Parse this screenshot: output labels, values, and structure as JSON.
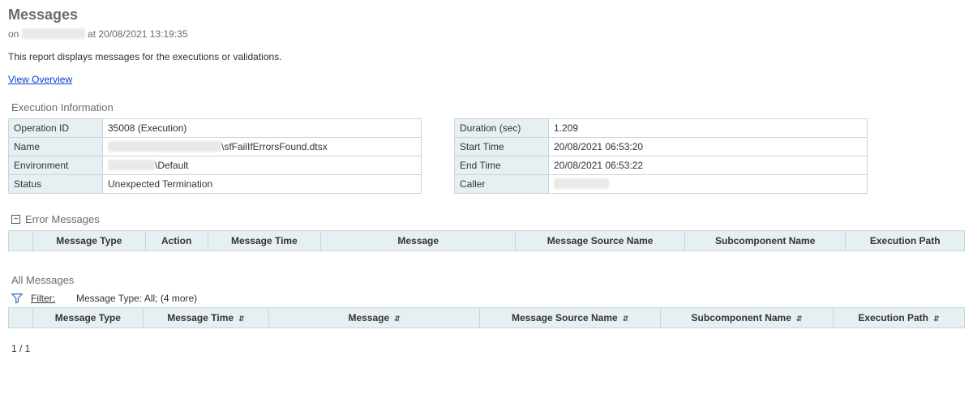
{
  "page": {
    "title": "Messages",
    "meta_prefix": "on",
    "meta_at": "at",
    "meta_datetime": "20/08/2021 13:19:35",
    "description": "This report displays messages for the executions or validations.",
    "overview_link": "View Overview"
  },
  "exec_info": {
    "heading": "Execution Information",
    "left": [
      {
        "label": "Operation ID",
        "value": "35008 (Execution)"
      },
      {
        "label": "Name",
        "value": "\\sfFailIfErrorsFound.dtsx",
        "redacted_prefix": true
      },
      {
        "label": "Environment",
        "value": "\\Default",
        "redacted_prefix": true
      },
      {
        "label": "Status",
        "value": "Unexpected Termination"
      }
    ],
    "right": [
      {
        "label": "Duration (sec)",
        "value": "1.209"
      },
      {
        "label": "Start Time",
        "value": "20/08/2021 06:53:20"
      },
      {
        "label": "End Time",
        "value": "20/08/2021 06:53:22"
      },
      {
        "label": "Caller",
        "value": "",
        "redacted_value": true
      }
    ]
  },
  "error_section": {
    "heading": "Error Messages",
    "columns": [
      "Message Type",
      "Action",
      "Message Time",
      "Message",
      "Message Source Name",
      "Subcomponent Name",
      "Execution Path"
    ]
  },
  "all_section": {
    "heading": "All Messages",
    "filter_label": "Filter:",
    "filter_text": "Message Type: All;  (4 more)",
    "columns": [
      {
        "label": "Message Type",
        "sortable": true
      },
      {
        "label": "Message Time",
        "sortable": true
      },
      {
        "label": "Message",
        "sortable": true
      },
      {
        "label": "Message Source Name",
        "sortable": true
      },
      {
        "label": "Subcomponent Name",
        "sortable": true
      },
      {
        "label": "Execution Path",
        "sortable": true
      }
    ]
  },
  "pager": {
    "text": "1 / 1"
  }
}
